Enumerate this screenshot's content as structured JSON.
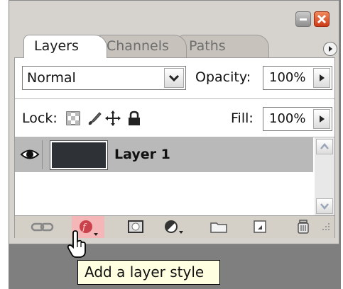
{
  "tabs": [
    {
      "label": "Layers",
      "active": true
    },
    {
      "label": "Channels",
      "active": false
    },
    {
      "label": "Paths",
      "active": false
    }
  ],
  "blend_mode": {
    "value": "Normal"
  },
  "opacity": {
    "label": "Opacity:",
    "value": "100%"
  },
  "lock": {
    "label": "Lock:",
    "icons": [
      "lock-transparent-pixels-icon",
      "lock-image-pixels-icon",
      "lock-position-icon",
      "lock-all-icon"
    ]
  },
  "fill": {
    "label": "Fill:",
    "value": "100%"
  },
  "layers": [
    {
      "name": "Layer 1",
      "visible": true,
      "selected": true
    }
  ],
  "bottom_icons": [
    "link-layers-icon",
    "layer-style-icon",
    "layer-mask-icon",
    "adjustment-layer-icon",
    "new-group-icon",
    "new-layer-icon",
    "delete-layer-icon"
  ],
  "tooltip": {
    "text": "Add a layer style"
  },
  "colors": {
    "panel": "#d6d3ce",
    "selected_row": "#b9b9b9",
    "tooltip_bg": "#ffffe1",
    "close_button": "#cc3b17",
    "hover_highlight": "#f4b6b6"
  }
}
